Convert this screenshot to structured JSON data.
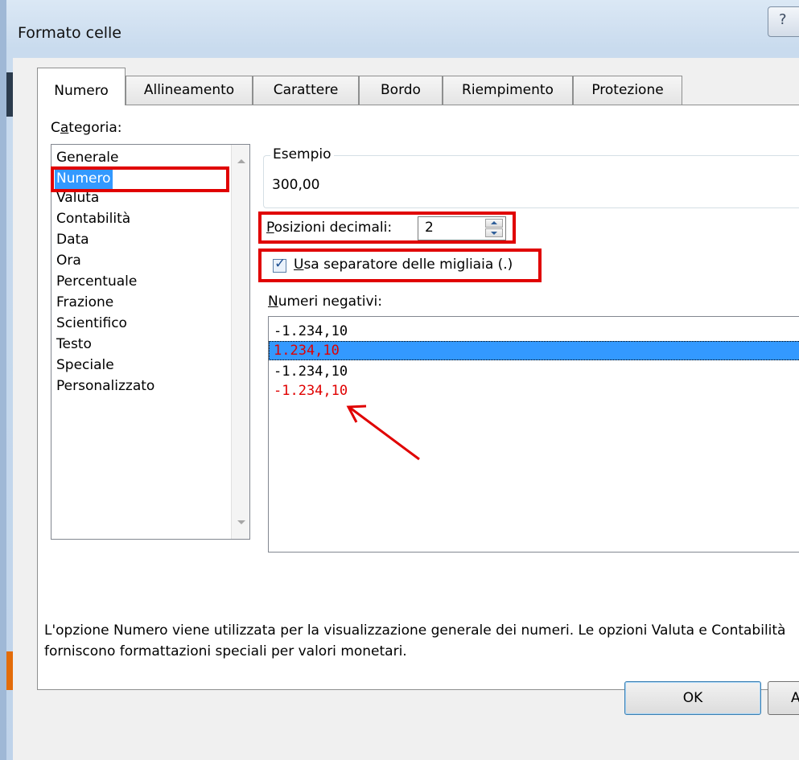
{
  "window": {
    "title": "Formato celle",
    "help_label": "?"
  },
  "tabs": [
    {
      "label": "Numero",
      "active": true
    },
    {
      "label": "Allineamento"
    },
    {
      "label": "Carattere"
    },
    {
      "label": "Bordo"
    },
    {
      "label": "Riempimento"
    },
    {
      "label": "Protezione"
    }
  ],
  "category": {
    "label_prefix": "C",
    "label_mnemonic": "a",
    "label_rest": "tegoria:",
    "items": [
      "Generale",
      "Numero",
      "Valuta",
      "Contabilità",
      "Data",
      "Ora",
      "Percentuale",
      "Frazione",
      "Scientifico",
      "Testo",
      "Speciale",
      "Personalizzato"
    ],
    "selected": "Numero"
  },
  "sample": {
    "legend": "Esempio",
    "value": "300,00"
  },
  "decimals": {
    "label_mnemonic": "P",
    "label_rest": "osizioni decimali:",
    "value": "2"
  },
  "thousands": {
    "label_mnemonic": "U",
    "label_rest": "sa separatore delle migliaia (.)",
    "checked": true
  },
  "negatives": {
    "label_mnemonic": "N",
    "label_rest": "umeri negativi:",
    "items": [
      "-1.234,10",
      "1.234,10",
      "-1.234,10",
      "-1.234,10"
    ],
    "selected_index": 1
  },
  "description": "L'opzione Numero viene utilizzata per la visualizzazione generale dei numeri. Le opzioni Valuta e Contabilità forniscono formattazioni speciali per valori monetari.",
  "buttons": {
    "ok": "OK",
    "cancel": "An"
  },
  "colors": {
    "selection": "#3399ff",
    "annotation_red": "#e00000",
    "negative_red": "#e00000"
  }
}
